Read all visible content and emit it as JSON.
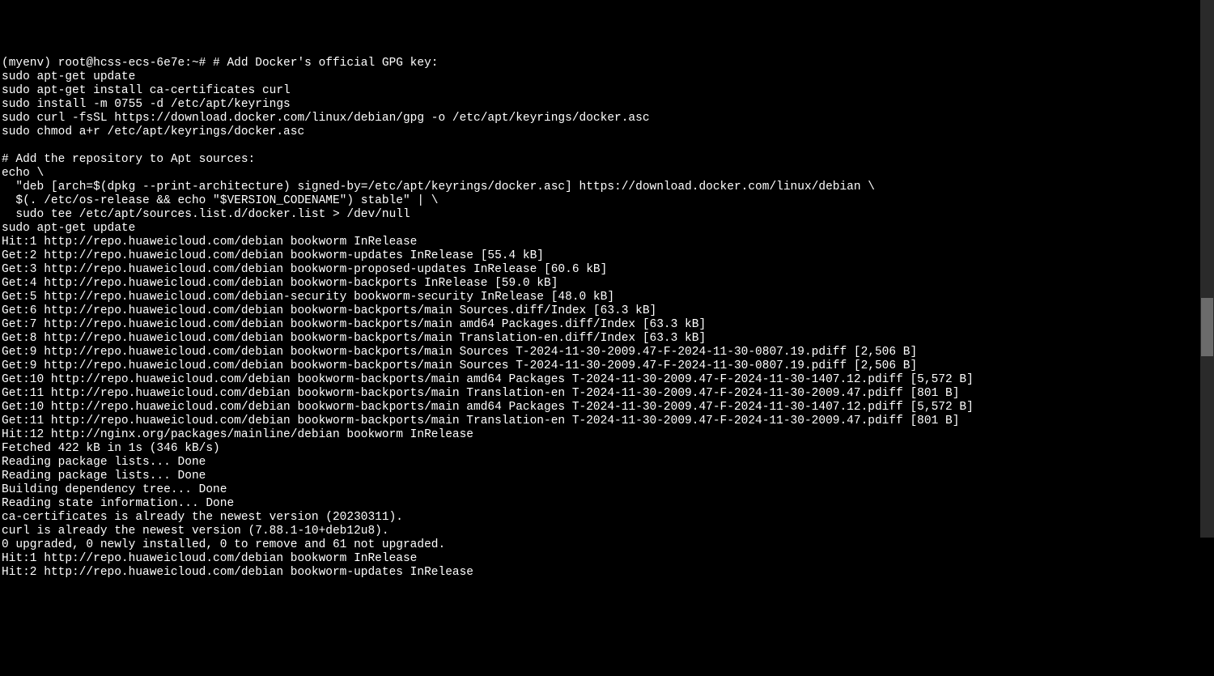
{
  "terminal": {
    "lines": [
      "(myenv) root@hcss-ecs-6e7e:~# # Add Docker's official GPG key:",
      "sudo apt-get update",
      "sudo apt-get install ca-certificates curl",
      "sudo install -m 0755 -d /etc/apt/keyrings",
      "sudo curl -fsSL https://download.docker.com/linux/debian/gpg -o /etc/apt/keyrings/docker.asc",
      "sudo chmod a+r /etc/apt/keyrings/docker.asc",
      "",
      "# Add the repository to Apt sources:",
      "echo \\",
      "  \"deb [arch=$(dpkg --print-architecture) signed-by=/etc/apt/keyrings/docker.asc] https://download.docker.com/linux/debian \\",
      "  $(. /etc/os-release && echo \"$VERSION_CODENAME\") stable\" | \\",
      "  sudo tee /etc/apt/sources.list.d/docker.list > /dev/null",
      "sudo apt-get update",
      "Hit:1 http://repo.huaweicloud.com/debian bookworm InRelease",
      "Get:2 http://repo.huaweicloud.com/debian bookworm-updates InRelease [55.4 kB]",
      "Get:3 http://repo.huaweicloud.com/debian bookworm-proposed-updates InRelease [60.6 kB]",
      "Get:4 http://repo.huaweicloud.com/debian bookworm-backports InRelease [59.0 kB]",
      "Get:5 http://repo.huaweicloud.com/debian-security bookworm-security InRelease [48.0 kB]",
      "Get:6 http://repo.huaweicloud.com/debian bookworm-backports/main Sources.diff/Index [63.3 kB]",
      "Get:7 http://repo.huaweicloud.com/debian bookworm-backports/main amd64 Packages.diff/Index [63.3 kB]",
      "Get:8 http://repo.huaweicloud.com/debian bookworm-backports/main Translation-en.diff/Index [63.3 kB]",
      "Get:9 http://repo.huaweicloud.com/debian bookworm-backports/main Sources T-2024-11-30-2009.47-F-2024-11-30-0807.19.pdiff [2,506 B]",
      "Get:9 http://repo.huaweicloud.com/debian bookworm-backports/main Sources T-2024-11-30-2009.47-F-2024-11-30-0807.19.pdiff [2,506 B]",
      "Get:10 http://repo.huaweicloud.com/debian bookworm-backports/main amd64 Packages T-2024-11-30-2009.47-F-2024-11-30-1407.12.pdiff [5,572 B]",
      "Get:11 http://repo.huaweicloud.com/debian bookworm-backports/main Translation-en T-2024-11-30-2009.47-F-2024-11-30-2009.47.pdiff [801 B]",
      "Get:10 http://repo.huaweicloud.com/debian bookworm-backports/main amd64 Packages T-2024-11-30-2009.47-F-2024-11-30-1407.12.pdiff [5,572 B]",
      "Get:11 http://repo.huaweicloud.com/debian bookworm-backports/main Translation-en T-2024-11-30-2009.47-F-2024-11-30-2009.47.pdiff [801 B]",
      "Hit:12 http://nginx.org/packages/mainline/debian bookworm InRelease",
      "Fetched 422 kB in 1s (346 kB/s)",
      "Reading package lists... Done",
      "Reading package lists... Done",
      "Building dependency tree... Done",
      "Reading state information... Done",
      "ca-certificates is already the newest version (20230311).",
      "curl is already the newest version (7.88.1-10+deb12u8).",
      "0 upgraded, 0 newly installed, 0 to remove and 61 not upgraded.",
      "Hit:1 http://repo.huaweicloud.com/debian bookworm InRelease",
      "Hit:2 http://repo.huaweicloud.com/debian bookworm-updates InRelease"
    ]
  }
}
